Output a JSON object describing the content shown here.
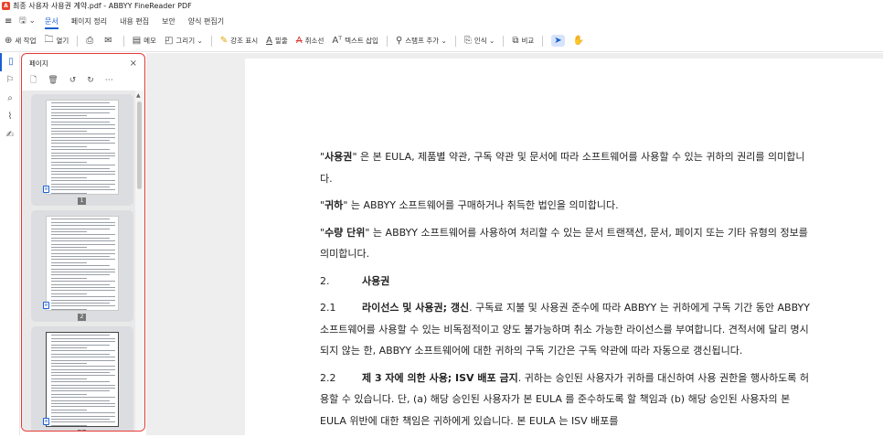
{
  "window": {
    "title": "최종 사용자 사용권 계약.pdf - ABBYY FineReader PDF"
  },
  "menu": {
    "tabs": [
      "문서",
      "페이지 정리",
      "내용 편집",
      "보안",
      "양식 편집기"
    ],
    "active_tab": "문서"
  },
  "toolbar": {
    "new_task": "새 작업",
    "open": "열기",
    "note": "메모",
    "draw": "그리기",
    "highlight": "강조 표시",
    "underline": "밑줄",
    "strikethrough": "취소선",
    "insert_text": "텍스트 삽입",
    "stamp": "스탬프 추가",
    "recognize": "인식",
    "compare": "비교"
  },
  "panel": {
    "title": "페이지",
    "close": "×",
    "pages": [
      {
        "number": "1"
      },
      {
        "number": "2"
      },
      {
        "number": "3"
      }
    ]
  },
  "document": {
    "def_use": {
      "term": "사용권",
      "text": " 은 본 EULA, 제품별 약관, 구독 약관 및 문서에 따라 소프트웨어를 사용할 수 있는 귀하의 권리를 의미합니다."
    },
    "def_you": {
      "term": "귀하",
      "text": " 는 ABBYY 소프트웨어를 구매하거나 취득한 법인을 의미합니다."
    },
    "def_unit": {
      "term": "수량 단위",
      "text": " 는 ABBYY 소프트웨어를 사용하여 처리할 수 있는 문서 트랜잭션, 문서, 페이지 또는 기타 유형의 정보를 의미합니다."
    },
    "section2": {
      "number": "2.",
      "title": "사용권"
    },
    "s21": {
      "number": "2.1",
      "title": "라이선스 및 사용권; 갱신",
      "text": ". 구독료 지불 및 사용권 준수에 따라 ABBYY 는 귀하에게 구독 기간 동안 ABBYY 소프트웨어를 사용할 수 있는 비독점적이고 양도 불가능하며 취소 가능한 라이선스를 부여합니다. 견적서에 달리 명시되지 않는 한, ABBYY 소프트웨어에 대한 귀하의 구독 기간은 구독 약관에 따라 자동으로 갱신됩니다."
    },
    "s22": {
      "number": "2.2",
      "title": "제 3 자에 의한 사용; ISV 배포 금지",
      "text": ". 귀하는 승인된 사용자가 귀하를 대신하여 사용 권한을 행사하도록 허용할 수 있습니다. 단, (a) 해당 승인된 사용자가 본 EULA 를 준수하도록 할 책임과 (b) 해당 승인된 사용자의 본 EULA 위반에 대한 책임은 귀하에게 있습니다. 본 EULA 는 ISV 배포를"
    }
  }
}
